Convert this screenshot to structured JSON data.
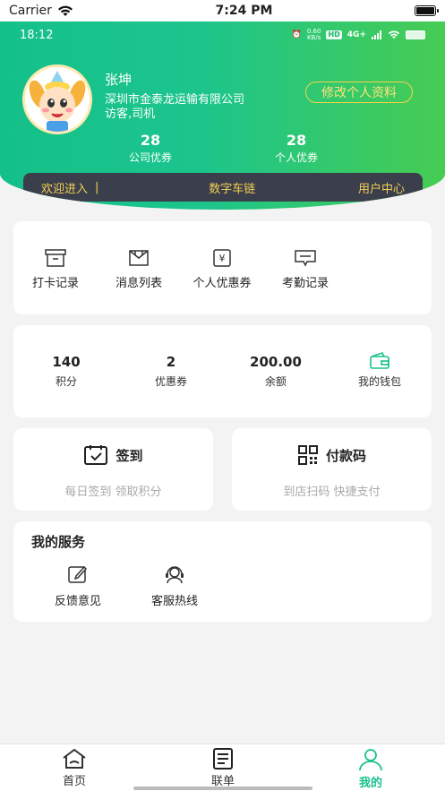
{
  "ios_status": {
    "carrier": "Carrier",
    "time": "7:24 PM"
  },
  "android_status": {
    "time": "18:12",
    "net_speed": "0.60\nKB/s",
    "net_type": "4G+"
  },
  "profile": {
    "name": "张坤",
    "company": "深圳市金泰龙运输有限公司",
    "role": "访客,司机",
    "edit_label": "修改个人资料"
  },
  "header_stats": [
    {
      "value": "28",
      "label": "公司优券"
    },
    {
      "value": "28",
      "label": "个人优券"
    }
  ],
  "welcome_bar": {
    "left": "欢迎进入",
    "separator": "|",
    "center": "数字车链",
    "right": "用户中心"
  },
  "quick_actions": [
    {
      "label": "打卡记录",
      "icon": "archive-box-icon"
    },
    {
      "label": "消息列表",
      "icon": "envelope-box-icon"
    },
    {
      "label": "个人优惠券",
      "icon": "coupon-icon"
    },
    {
      "label": "考勤记录",
      "icon": "message-icon"
    }
  ],
  "assets": [
    {
      "value": "140",
      "label": "积分"
    },
    {
      "value": "2",
      "label": "优惠券"
    },
    {
      "value": "200.00",
      "label": "余额"
    },
    {
      "value": "",
      "label": "我的钱包"
    }
  ],
  "checkin": {
    "title": "签到",
    "subtitle": "每日签到 领取积分"
  },
  "paycode": {
    "title": "付款码",
    "subtitle": "到店扫码 快捷支付"
  },
  "services": {
    "title": "我的服务",
    "items": [
      {
        "label": "反馈意见",
        "icon": "edit-icon"
      },
      {
        "label": "客服热线",
        "icon": "headset-icon"
      }
    ]
  },
  "tabs": [
    {
      "label": "首页",
      "icon": "home-icon",
      "active": false
    },
    {
      "label": "联单",
      "icon": "document-icon",
      "active": false
    },
    {
      "label": "我的",
      "icon": "person-icon",
      "active": true
    }
  ],
  "colors": {
    "accent": "#19c28d",
    "header_start": "#14c08a",
    "header_end": "#47cc52",
    "gold": "#f2cf55",
    "bar_dark": "#3b3f4b"
  }
}
